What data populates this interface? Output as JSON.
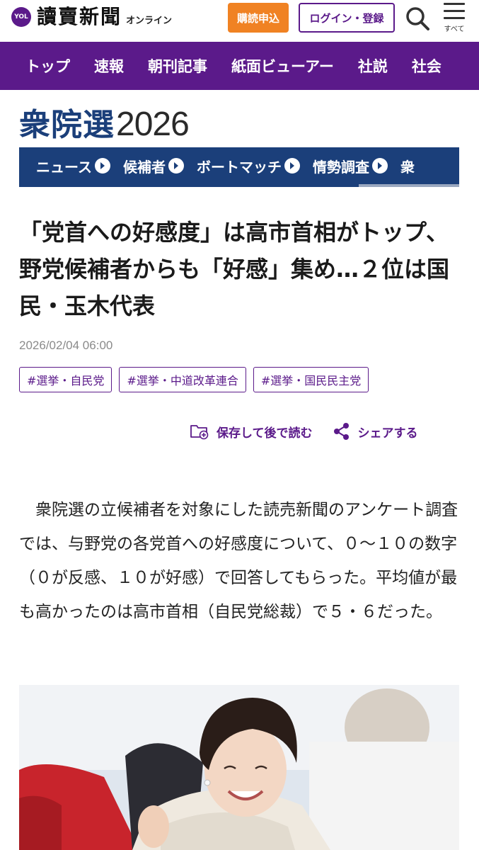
{
  "header": {
    "logo_mark": "YOL",
    "logo_title": "讀賣新聞",
    "logo_sub": "オンライン",
    "subscribe_label": "購読申込",
    "login_label": "ログイン・登録",
    "menu_label": "すべて"
  },
  "nav": {
    "items": [
      "トップ",
      "速報",
      "朝刊記事",
      "紙面ビューアー",
      "社説",
      "社会"
    ]
  },
  "election": {
    "title_jp": "衆院選",
    "title_year": "2026",
    "tabs": [
      "ニュース",
      "候補者",
      "ボートマッチ",
      "情勢調査",
      "衆"
    ]
  },
  "article": {
    "headline": "「党首への好感度」は高市首相がトップ、野党候補者からも「好感」集め…２位は国民・玉木代表",
    "date": "2026/02/04 06:00",
    "tags": [
      "#選挙・自民党",
      "#選挙・中道改革連合",
      "#選挙・国民民主党"
    ],
    "save_label": "保存して後で読む",
    "share_label": "シェアする",
    "body": "　衆院選の立候補者を対象にした読売新聞のアンケート調査では、与野党の各党首への好感度について、０〜１０の数字（０が反感、１０が好感）で回答してもらった。平均値が最も高かったのは高市首相（自民党総裁）で５・６だった。"
  },
  "colors": {
    "brand_purple": "#5b1a8a",
    "subscribe_orange": "#f08223",
    "election_navy": "#1b3f7a"
  }
}
